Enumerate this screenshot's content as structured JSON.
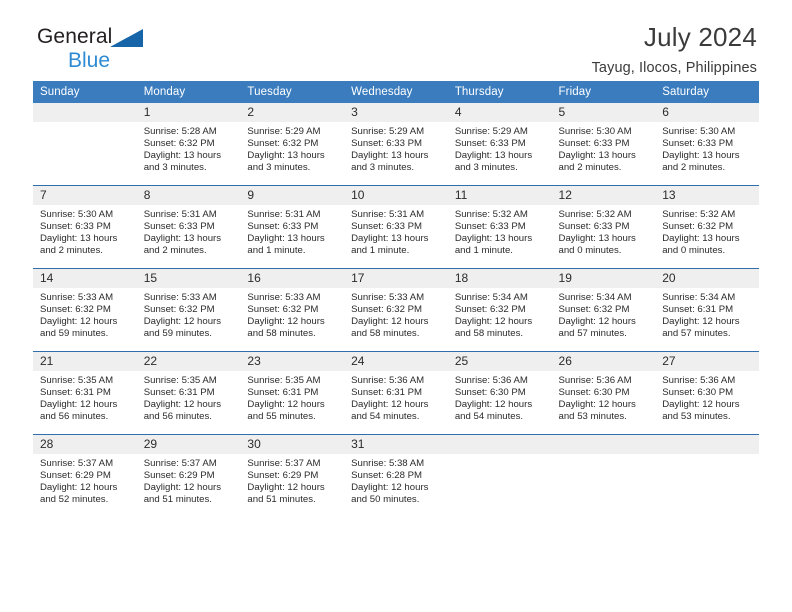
{
  "brand": {
    "name_part1": "General",
    "name_part2": "Blue",
    "triangle_color": "#1565a8",
    "blue_color": "#2e8bd4"
  },
  "header": {
    "title": "July 2024",
    "subtitle": "Tayug, Ilocos, Philippines"
  },
  "colors": {
    "header_row_bg": "#3a7cbe",
    "header_row_text": "#ffffff",
    "daynum_bg": "#efefef",
    "week_separator": "#2f6fae",
    "body_text": "#2b2b2b"
  },
  "weekday_headers": [
    "Sunday",
    "Monday",
    "Tuesday",
    "Wednesday",
    "Thursday",
    "Friday",
    "Saturday"
  ],
  "labels": {
    "sunrise_prefix": "Sunrise:",
    "sunset_prefix": "Sunset:",
    "daylight_prefix": "Daylight:"
  },
  "weeks": [
    {
      "days": [
        {
          "num": "",
          "sunrise": "",
          "sunset": "",
          "daylight_line1": "",
          "daylight_line2": "",
          "empty": true
        },
        {
          "num": "1",
          "sunrise": "Sunrise: 5:28 AM",
          "sunset": "Sunset: 6:32 PM",
          "daylight_line1": "Daylight: 13 hours",
          "daylight_line2": "and 3 minutes.",
          "empty": false
        },
        {
          "num": "2",
          "sunrise": "Sunrise: 5:29 AM",
          "sunset": "Sunset: 6:32 PM",
          "daylight_line1": "Daylight: 13 hours",
          "daylight_line2": "and 3 minutes.",
          "empty": false
        },
        {
          "num": "3",
          "sunrise": "Sunrise: 5:29 AM",
          "sunset": "Sunset: 6:33 PM",
          "daylight_line1": "Daylight: 13 hours",
          "daylight_line2": "and 3 minutes.",
          "empty": false
        },
        {
          "num": "4",
          "sunrise": "Sunrise: 5:29 AM",
          "sunset": "Sunset: 6:33 PM",
          "daylight_line1": "Daylight: 13 hours",
          "daylight_line2": "and 3 minutes.",
          "empty": false
        },
        {
          "num": "5",
          "sunrise": "Sunrise: 5:30 AM",
          "sunset": "Sunset: 6:33 PM",
          "daylight_line1": "Daylight: 13 hours",
          "daylight_line2": "and 2 minutes.",
          "empty": false
        },
        {
          "num": "6",
          "sunrise": "Sunrise: 5:30 AM",
          "sunset": "Sunset: 6:33 PM",
          "daylight_line1": "Daylight: 13 hours",
          "daylight_line2": "and 2 minutes.",
          "empty": false
        }
      ]
    },
    {
      "days": [
        {
          "num": "7",
          "sunrise": "Sunrise: 5:30 AM",
          "sunset": "Sunset: 6:33 PM",
          "daylight_line1": "Daylight: 13 hours",
          "daylight_line2": "and 2 minutes.",
          "empty": false
        },
        {
          "num": "8",
          "sunrise": "Sunrise: 5:31 AM",
          "sunset": "Sunset: 6:33 PM",
          "daylight_line1": "Daylight: 13 hours",
          "daylight_line2": "and 2 minutes.",
          "empty": false
        },
        {
          "num": "9",
          "sunrise": "Sunrise: 5:31 AM",
          "sunset": "Sunset: 6:33 PM",
          "daylight_line1": "Daylight: 13 hours",
          "daylight_line2": "and 1 minute.",
          "empty": false
        },
        {
          "num": "10",
          "sunrise": "Sunrise: 5:31 AM",
          "sunset": "Sunset: 6:33 PM",
          "daylight_line1": "Daylight: 13 hours",
          "daylight_line2": "and 1 minute.",
          "empty": false
        },
        {
          "num": "11",
          "sunrise": "Sunrise: 5:32 AM",
          "sunset": "Sunset: 6:33 PM",
          "daylight_line1": "Daylight: 13 hours",
          "daylight_line2": "and 1 minute.",
          "empty": false
        },
        {
          "num": "12",
          "sunrise": "Sunrise: 5:32 AM",
          "sunset": "Sunset: 6:33 PM",
          "daylight_line1": "Daylight: 13 hours",
          "daylight_line2": "and 0 minutes.",
          "empty": false
        },
        {
          "num": "13",
          "sunrise": "Sunrise: 5:32 AM",
          "sunset": "Sunset: 6:32 PM",
          "daylight_line1": "Daylight: 13 hours",
          "daylight_line2": "and 0 minutes.",
          "empty": false
        }
      ]
    },
    {
      "days": [
        {
          "num": "14",
          "sunrise": "Sunrise: 5:33 AM",
          "sunset": "Sunset: 6:32 PM",
          "daylight_line1": "Daylight: 12 hours",
          "daylight_line2": "and 59 minutes.",
          "empty": false
        },
        {
          "num": "15",
          "sunrise": "Sunrise: 5:33 AM",
          "sunset": "Sunset: 6:32 PM",
          "daylight_line1": "Daylight: 12 hours",
          "daylight_line2": "and 59 minutes.",
          "empty": false
        },
        {
          "num": "16",
          "sunrise": "Sunrise: 5:33 AM",
          "sunset": "Sunset: 6:32 PM",
          "daylight_line1": "Daylight: 12 hours",
          "daylight_line2": "and 58 minutes.",
          "empty": false
        },
        {
          "num": "17",
          "sunrise": "Sunrise: 5:33 AM",
          "sunset": "Sunset: 6:32 PM",
          "daylight_line1": "Daylight: 12 hours",
          "daylight_line2": "and 58 minutes.",
          "empty": false
        },
        {
          "num": "18",
          "sunrise": "Sunrise: 5:34 AM",
          "sunset": "Sunset: 6:32 PM",
          "daylight_line1": "Daylight: 12 hours",
          "daylight_line2": "and 58 minutes.",
          "empty": false
        },
        {
          "num": "19",
          "sunrise": "Sunrise: 5:34 AM",
          "sunset": "Sunset: 6:32 PM",
          "daylight_line1": "Daylight: 12 hours",
          "daylight_line2": "and 57 minutes.",
          "empty": false
        },
        {
          "num": "20",
          "sunrise": "Sunrise: 5:34 AM",
          "sunset": "Sunset: 6:31 PM",
          "daylight_line1": "Daylight: 12 hours",
          "daylight_line2": "and 57 minutes.",
          "empty": false
        }
      ]
    },
    {
      "days": [
        {
          "num": "21",
          "sunrise": "Sunrise: 5:35 AM",
          "sunset": "Sunset: 6:31 PM",
          "daylight_line1": "Daylight: 12 hours",
          "daylight_line2": "and 56 minutes.",
          "empty": false
        },
        {
          "num": "22",
          "sunrise": "Sunrise: 5:35 AM",
          "sunset": "Sunset: 6:31 PM",
          "daylight_line1": "Daylight: 12 hours",
          "daylight_line2": "and 56 minutes.",
          "empty": false
        },
        {
          "num": "23",
          "sunrise": "Sunrise: 5:35 AM",
          "sunset": "Sunset: 6:31 PM",
          "daylight_line1": "Daylight: 12 hours",
          "daylight_line2": "and 55 minutes.",
          "empty": false
        },
        {
          "num": "24",
          "sunrise": "Sunrise: 5:36 AM",
          "sunset": "Sunset: 6:31 PM",
          "daylight_line1": "Daylight: 12 hours",
          "daylight_line2": "and 54 minutes.",
          "empty": false
        },
        {
          "num": "25",
          "sunrise": "Sunrise: 5:36 AM",
          "sunset": "Sunset: 6:30 PM",
          "daylight_line1": "Daylight: 12 hours",
          "daylight_line2": "and 54 minutes.",
          "empty": false
        },
        {
          "num": "26",
          "sunrise": "Sunrise: 5:36 AM",
          "sunset": "Sunset: 6:30 PM",
          "daylight_line1": "Daylight: 12 hours",
          "daylight_line2": "and 53 minutes.",
          "empty": false
        },
        {
          "num": "27",
          "sunrise": "Sunrise: 5:36 AM",
          "sunset": "Sunset: 6:30 PM",
          "daylight_line1": "Daylight: 12 hours",
          "daylight_line2": "and 53 minutes.",
          "empty": false
        }
      ]
    },
    {
      "days": [
        {
          "num": "28",
          "sunrise": "Sunrise: 5:37 AM",
          "sunset": "Sunset: 6:29 PM",
          "daylight_line1": "Daylight: 12 hours",
          "daylight_line2": "and 52 minutes.",
          "empty": false
        },
        {
          "num": "29",
          "sunrise": "Sunrise: 5:37 AM",
          "sunset": "Sunset: 6:29 PM",
          "daylight_line1": "Daylight: 12 hours",
          "daylight_line2": "and 51 minutes.",
          "empty": false
        },
        {
          "num": "30",
          "sunrise": "Sunrise: 5:37 AM",
          "sunset": "Sunset: 6:29 PM",
          "daylight_line1": "Daylight: 12 hours",
          "daylight_line2": "and 51 minutes.",
          "empty": false
        },
        {
          "num": "31",
          "sunrise": "Sunrise: 5:38 AM",
          "sunset": "Sunset: 6:28 PM",
          "daylight_line1": "Daylight: 12 hours",
          "daylight_line2": "and 50 minutes.",
          "empty": false
        },
        {
          "num": "",
          "sunrise": "",
          "sunset": "",
          "daylight_line1": "",
          "daylight_line2": "",
          "empty": true
        },
        {
          "num": "",
          "sunrise": "",
          "sunset": "",
          "daylight_line1": "",
          "daylight_line2": "",
          "empty": true
        },
        {
          "num": "",
          "sunrise": "",
          "sunset": "",
          "daylight_line1": "",
          "daylight_line2": "",
          "empty": true
        }
      ]
    }
  ]
}
